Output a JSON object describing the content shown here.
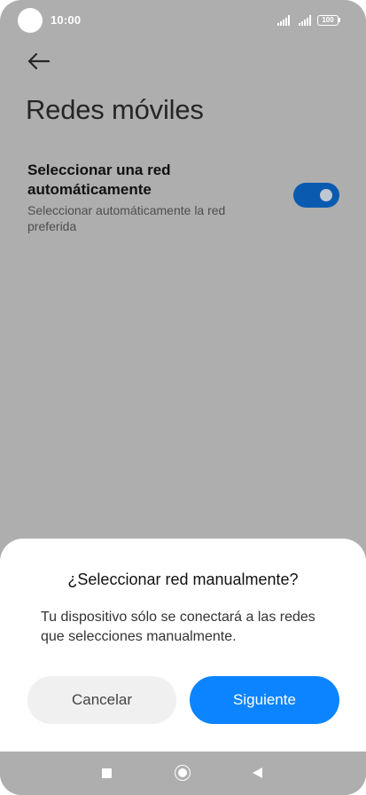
{
  "status_bar": {
    "time": "10:00",
    "battery": "100",
    "icons": [
      "signal-icon",
      "signal-icon",
      "battery-icon"
    ]
  },
  "header": {
    "back_icon": "arrow-left-icon",
    "title": "Redes móviles"
  },
  "setting": {
    "title": "Seleccionar una red automáticamente",
    "subtitle": "Seleccionar automáticamente la red preferida",
    "toggle_on": true
  },
  "dialog": {
    "title": "¿Seleccionar red manualmente?",
    "message": "Tu dispositivo sólo se conectará a las redes que selecciones manualmente.",
    "cancel_label": "Cancelar",
    "next_label": "Siguiente"
  },
  "nav_bar": {
    "icons": [
      "recents-square-icon",
      "home-circle-icon",
      "back-triangle-icon"
    ]
  },
  "colors": {
    "background_dim": "#aeaeae",
    "toggle_on": "#0a5bb0",
    "primary_button": "#0d84ff",
    "secondary_button": "#f0f0f0"
  }
}
